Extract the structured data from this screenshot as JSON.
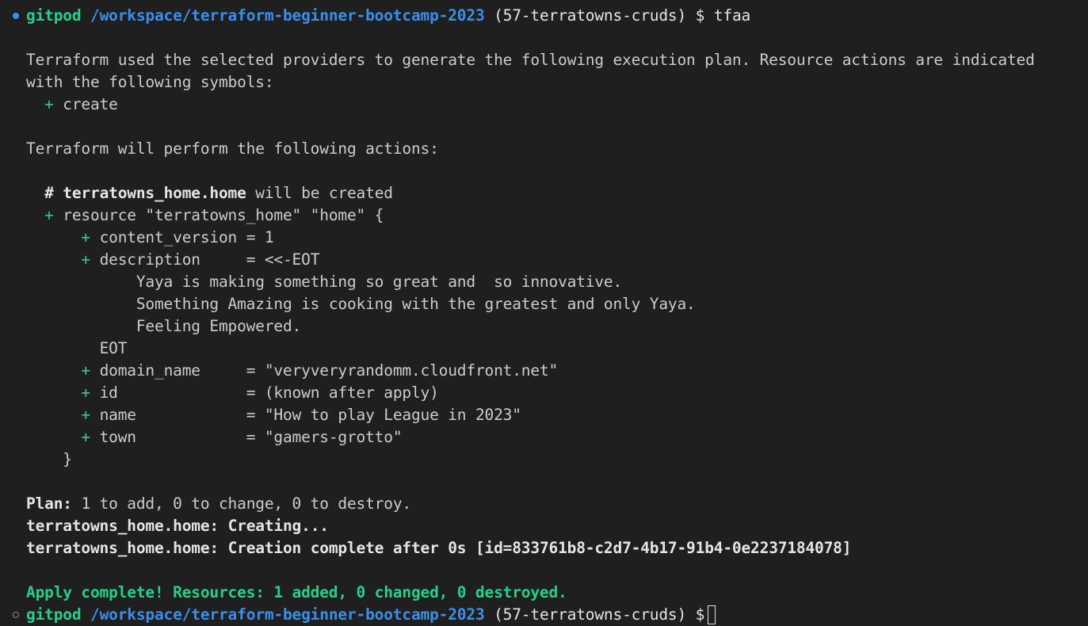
{
  "prompt": {
    "user": "gitpod",
    "path": "/workspace/terraform-beginner-bootcamp-2023",
    "branch": "(57-terratowns-cruds)",
    "symbol": "$",
    "command": "tfaa"
  },
  "intro": {
    "line1": "Terraform used the selected providers to generate the following execution plan. Resource actions are indicated",
    "line2": "with the following symbols:",
    "create_sign": "+",
    "create_label": "create"
  },
  "actions_heading": "Terraform will perform the following actions:",
  "resource": {
    "comment_hash": "#",
    "comment_name": "terratowns_home.home",
    "comment_suffix": "will be created",
    "plus": "+",
    "declaration": "resource \"terratowns_home\" \"home\" {",
    "attributes": [
      {
        "sign": "+",
        "text": "content_version = 1"
      },
      {
        "sign": "+",
        "text": "description     = <<-EOT"
      }
    ],
    "heredoc": [
      "Yaya is making something so great and  so innovative.",
      "Something Amazing is cooking with the greatest and only Yaya.",
      "Feeling Empowered."
    ],
    "heredoc_end": "EOT",
    "attributes_after": [
      {
        "sign": "+",
        "text": "domain_name     = \"veryveryrandomm.cloudfront.net\""
      },
      {
        "sign": "+",
        "text": "id              = (known after apply)"
      },
      {
        "sign": "+",
        "text": "name            = \"How to play League in 2023\""
      },
      {
        "sign": "+",
        "text": "town            = \"gamers-grotto\""
      }
    ],
    "closing_brace": "}"
  },
  "plan": {
    "label": "Plan:",
    "summary": "1 to add, 0 to change, 0 to destroy."
  },
  "creating": {
    "resource": "terratowns_home.home:",
    "status": "Creating..."
  },
  "complete": {
    "resource": "terratowns_home.home:",
    "status": "Creation complete after 0s [id=833761b8-c2d7-4b17-91b4-0e2237184078]"
  },
  "apply_result": "Apply complete! Resources: 1 added, 0 changed, 0 destroyed.",
  "colors": {
    "background": "#1f1f1f",
    "text": "#cccccc",
    "green": "#23d18b",
    "blue": "#3b8eea",
    "status_dot_active": "#3794ff"
  }
}
